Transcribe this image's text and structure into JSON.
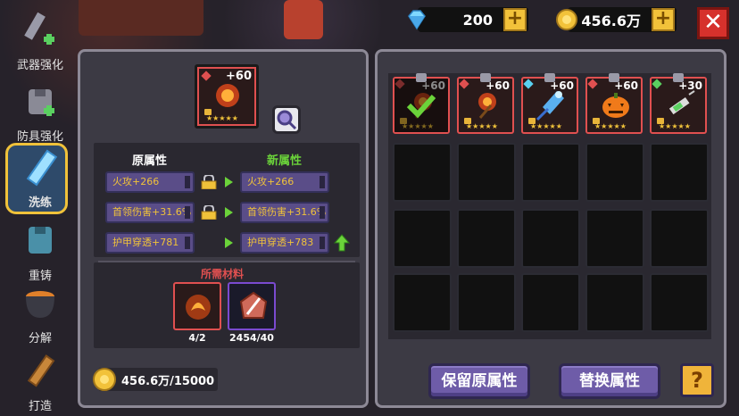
{
  "currency": {
    "gems": "200",
    "gold": "456.6万"
  },
  "sidebar": {
    "items": [
      {
        "label": "武器强化",
        "icon": "sword-upgrade-icon"
      },
      {
        "label": "防具强化",
        "icon": "armor-upgrade-icon"
      },
      {
        "label": "洗练",
        "icon": "reforge-sword-icon",
        "active": true
      },
      {
        "label": "重铸",
        "icon": "recast-armor-icon"
      },
      {
        "label": "分解",
        "icon": "cauldron-icon"
      },
      {
        "label": "打造",
        "icon": "forge-sword-icon"
      }
    ]
  },
  "left_panel": {
    "selected_item": {
      "level": "+60"
    },
    "headers": {
      "old": "原属性",
      "new": "新属性"
    },
    "old_attrs": [
      "火攻+266",
      "首领伤害+31.6%",
      "护甲穿透+781"
    ],
    "new_attrs": [
      "火攻+266",
      "首领伤害+31.6%",
      "护甲穿透+783"
    ],
    "materials_title": "所需材料",
    "materials": [
      {
        "count": "4/2",
        "icon": "fire-orb-icon"
      },
      {
        "count": "2454/40",
        "icon": "reforge-stone-icon"
      }
    ],
    "gold_cost": "456.6万/15000"
  },
  "inventory": {
    "items": [
      {
        "level": "+60",
        "gem": "#e05050",
        "icon": "fire-staff-icon",
        "selected": true
      },
      {
        "level": "+60",
        "gem": "#e05050",
        "icon": "fire-staff-icon"
      },
      {
        "level": "+60",
        "gem": "#5ad0f0",
        "icon": "ice-staff-icon"
      },
      {
        "level": "+60",
        "gem": "#e05050",
        "icon": "pumpkin-icon"
      },
      {
        "level": "+30",
        "gem": "#5ad060",
        "icon": "syringe-icon"
      }
    ]
  },
  "buttons": {
    "keep": "保留原属性",
    "replace": "替换属性",
    "help": "?"
  },
  "colors": {
    "accent_gold": "#f0c23a",
    "button_purple": "#6e5ca8",
    "close_red": "#d6312c"
  }
}
